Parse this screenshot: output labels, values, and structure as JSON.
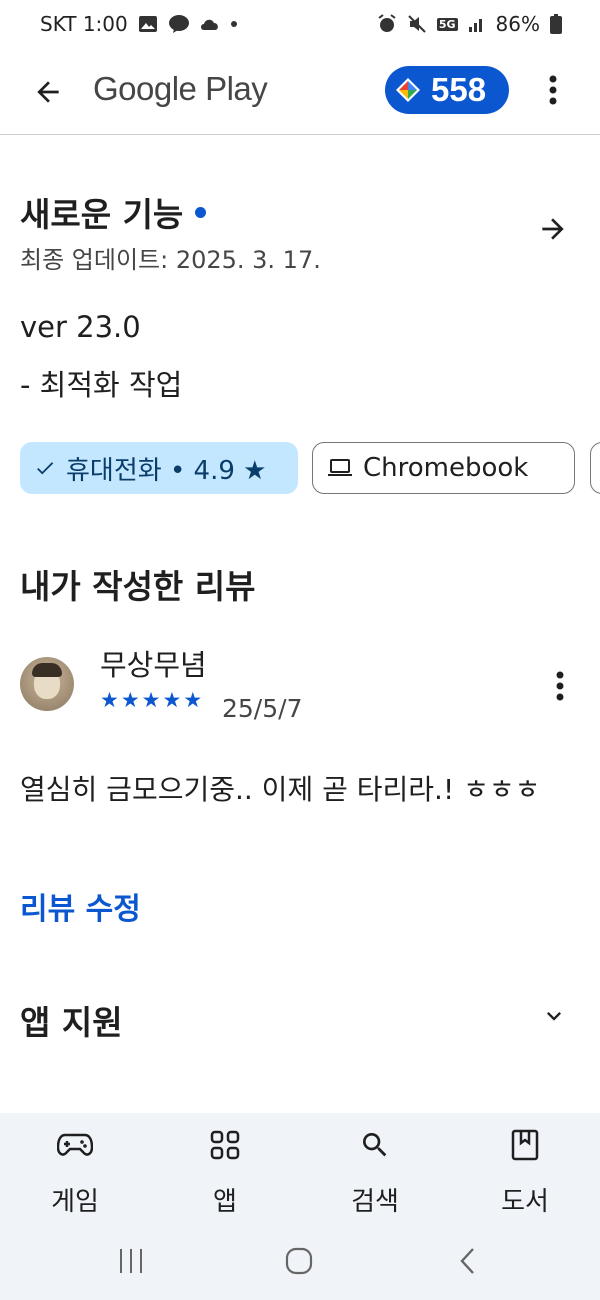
{
  "status_bar": {
    "time_carrier": "SKT 1:00",
    "battery": "86%",
    "network": "5G"
  },
  "appbar": {
    "brand": "Google Play",
    "points": "558"
  },
  "whats_new": {
    "title": "새로운 기능",
    "last_updated": "최종 업데이트: 2025. 3. 17.",
    "version": "ver 23.0",
    "changes": "- 최적화 작업"
  },
  "device_chips": [
    {
      "label": "휴대전화 • 4.9 ★",
      "selected": true
    },
    {
      "label": "Chromebook",
      "selected": false
    }
  ],
  "my_review": {
    "section_title": "내가 작성한 리뷰",
    "reviewer": "무상무념",
    "stars": 5,
    "date": "25/5/7",
    "text": "열심히 금모으기중.. 이제 곧 타리라.! ㅎㅎㅎ",
    "edit_label": "리뷰 수정"
  },
  "app_support": {
    "title": "앱 지원"
  },
  "bottom_nav": [
    {
      "label": "게임",
      "icon": "gamepad-icon"
    },
    {
      "label": "앱",
      "icon": "apps-grid-icon"
    },
    {
      "label": "검색",
      "icon": "search-icon"
    },
    {
      "label": "도서",
      "icon": "book-icon"
    }
  ],
  "colors": {
    "accent": "#0b57d0",
    "chip_selected_bg": "#c2e7ff",
    "nav_bg": "#f0f4f9"
  }
}
